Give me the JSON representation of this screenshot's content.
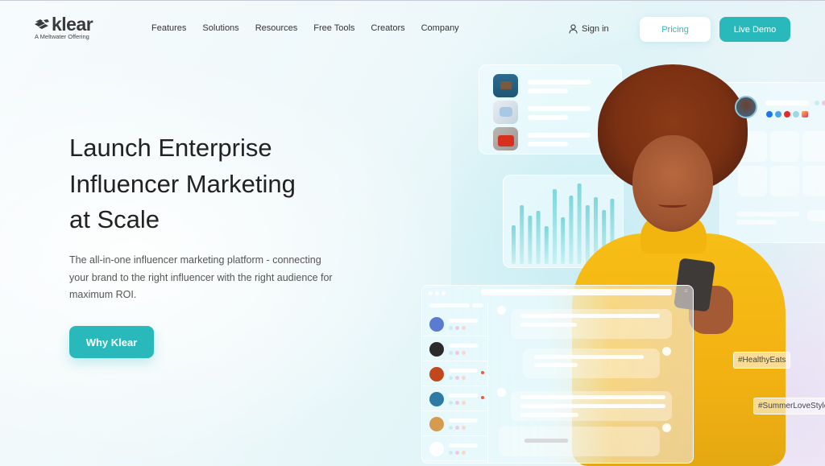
{
  "brand": {
    "name": "klear",
    "tagline": "A Meltwater Offering",
    "accent": "#29b9ba"
  },
  "nav": {
    "items": [
      {
        "label": "Features"
      },
      {
        "label": "Solutions"
      },
      {
        "label": "Resources"
      },
      {
        "label": "Free Tools"
      },
      {
        "label": "Creators"
      },
      {
        "label": "Company"
      }
    ],
    "signin_label": "Sign in",
    "pricing_label": "Pricing",
    "demo_label": "Live Demo"
  },
  "hero": {
    "title_lines": [
      "Launch Enterprise",
      "Influencer Marketing",
      "at Scale"
    ],
    "description": "The all-in-one influencer marketing platform - connecting your brand to the right influencer with the right audience for maximum ROI.",
    "cta_label": "Why Klear"
  },
  "visual": {
    "products_card": {
      "items": [
        {
          "icon": "briefcase-bag"
        },
        {
          "icon": "blue-handbag"
        },
        {
          "icon": "red-handbag"
        }
      ]
    },
    "bar_chart": {
      "relative_heights": [
        0.48,
        0.73,
        0.6,
        0.66,
        0.47,
        0.93,
        0.58,
        0.85,
        1.0,
        0.73,
        0.83,
        0.67,
        0.81
      ]
    },
    "profile_card": {
      "social_icons": [
        "facebook-icon",
        "twitter-icon",
        "youtube-icon",
        "tiktok-icon",
        "instagram-icon"
      ]
    },
    "chat_window": {
      "contacts": 6,
      "unread_indicators": [
        false,
        false,
        true,
        true,
        false,
        false
      ]
    },
    "hashtags": [
      "#HealthyEats",
      "#SummerLoveStyle"
    ]
  }
}
